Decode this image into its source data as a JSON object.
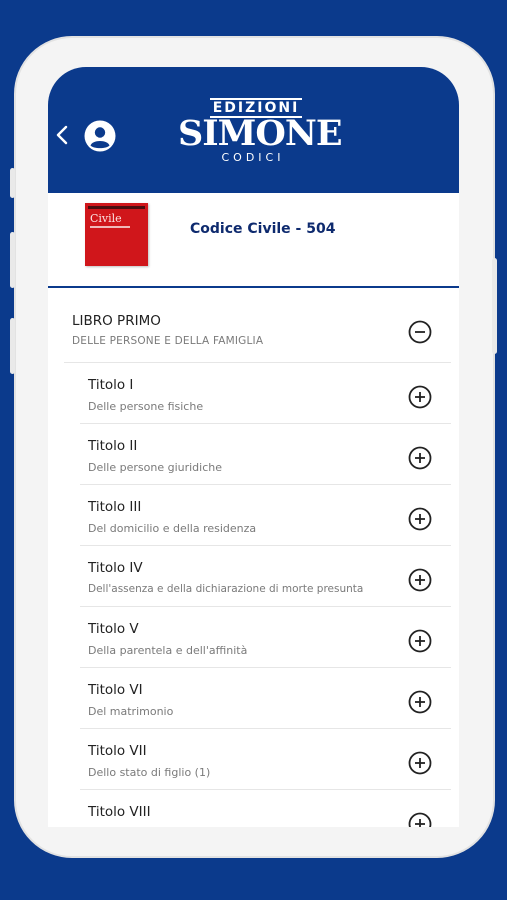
{
  "header": {
    "logo_top": "EDIZIONI",
    "logo_main": "SIMONE",
    "logo_sub": "CODICI"
  },
  "book": {
    "cover_title": "Civile",
    "title": "Codice Civile - 504"
  },
  "libro": {
    "title": "LIBRO PRIMO",
    "subtitle": "DELLE PERSONE E DELLA FAMIGLIA"
  },
  "titoli": [
    {
      "title": "Titolo I",
      "subtitle": "Delle persone fisiche"
    },
    {
      "title": "Titolo II",
      "subtitle": "Delle persone giuridiche"
    },
    {
      "title": "Titolo III",
      "subtitle": "Del domicilio e della residenza"
    },
    {
      "title": "Titolo IV",
      "subtitle": "Dell'assenza e della dichiarazione di morte presunta"
    },
    {
      "title": "Titolo V",
      "subtitle": "Della parentela e dell'affinità"
    },
    {
      "title": "Titolo VI",
      "subtitle": "Del matrimonio"
    },
    {
      "title": "Titolo VII",
      "subtitle": "Dello stato di figlio (1)"
    },
    {
      "title": "Titolo VIII",
      "subtitle": ""
    }
  ],
  "colors": {
    "brand": "#0b3a8c",
    "cover": "#d0161b"
  }
}
